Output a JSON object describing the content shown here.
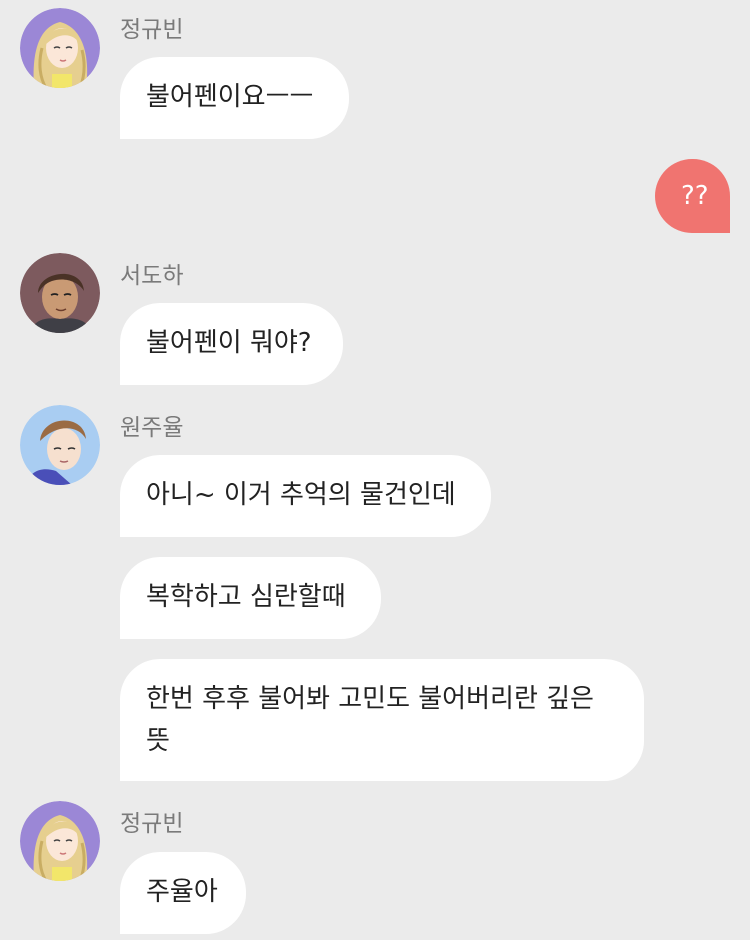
{
  "messages": [
    {
      "sender": "정규빈",
      "avatar": "avatar-jeong-gyubin-icon",
      "text": "불어펜이요ㅡㅡ"
    },
    {
      "sender": "me",
      "text": "??"
    },
    {
      "sender": "서도하",
      "avatar": "avatar-seo-doha-icon",
      "text": "불어펜이 뭐야?"
    },
    {
      "sender": "원주율",
      "avatar": "avatar-won-juyul-icon",
      "texts": [
        "아니~ 이거 추억의 물건인데",
        "복학하고 심란할때",
        "한번 후후 불어봐 고민도 불어버리란 깊은 뜻"
      ]
    },
    {
      "sender": "정규빈",
      "avatar": "avatar-jeong-gyubin-icon",
      "text": "주율아"
    }
  ],
  "colors": {
    "background": "#ebebeb",
    "bubble_other": "#ffffff",
    "bubble_mine": "#f07470",
    "sender_name": "#7a7a7a"
  }
}
